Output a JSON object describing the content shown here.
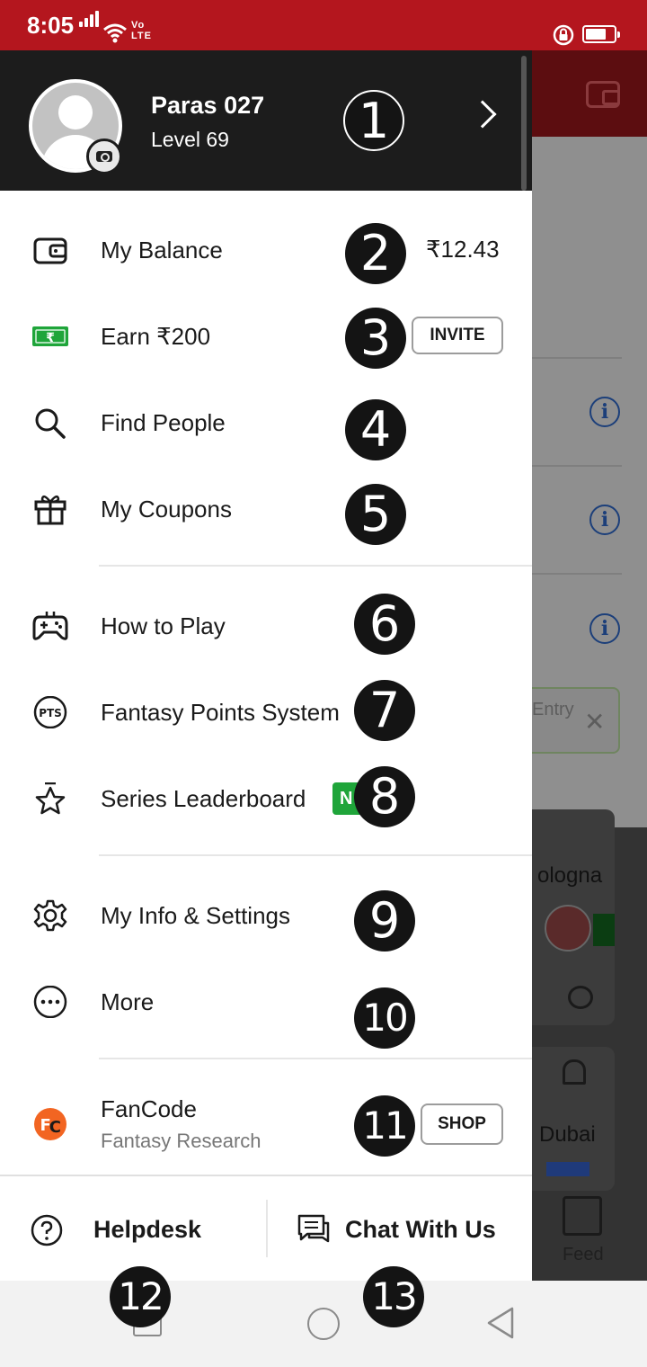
{
  "status_bar": {
    "time": "8:05",
    "network_label": "Vo\nLTE"
  },
  "profile": {
    "name": "Paras 027",
    "level": "Level 69"
  },
  "menu": {
    "balance_label": "My Balance",
    "balance_amount": "₹12.43",
    "earn_label": "Earn ₹200",
    "invite_label": "INVITE",
    "find_people_label": "Find People",
    "coupons_label": "My Coupons",
    "how_to_play_label": "How to Play",
    "fantasy_points_label": "Fantasy Points System",
    "pts_icon_text": "PTS",
    "series_leaderboard_label": "Series Leaderboard",
    "new_badge": "N",
    "settings_label": "My Info & Settings",
    "more_label": "More",
    "fancode_label": "FanCode",
    "fancode_sublabel": "Fantasy Research",
    "shop_label": "SHOP"
  },
  "footer": {
    "helpdesk_label": "Helpdesk",
    "chat_label": "Chat With Us"
  },
  "background": {
    "entry_text": "Entry",
    "team_text_1": "ologna",
    "team_text_2": "Dubai",
    "feed_label": "Feed"
  },
  "markers": [
    "1",
    "2",
    "3",
    "4",
    "5",
    "6",
    "7",
    "8",
    "9",
    "10",
    "11",
    "12",
    "13"
  ],
  "colors": {
    "status_bar": "#b4161e",
    "profile_header": "#1c1c1c",
    "new_badge": "#1fa53a",
    "fancode_orange": "#f26522"
  }
}
